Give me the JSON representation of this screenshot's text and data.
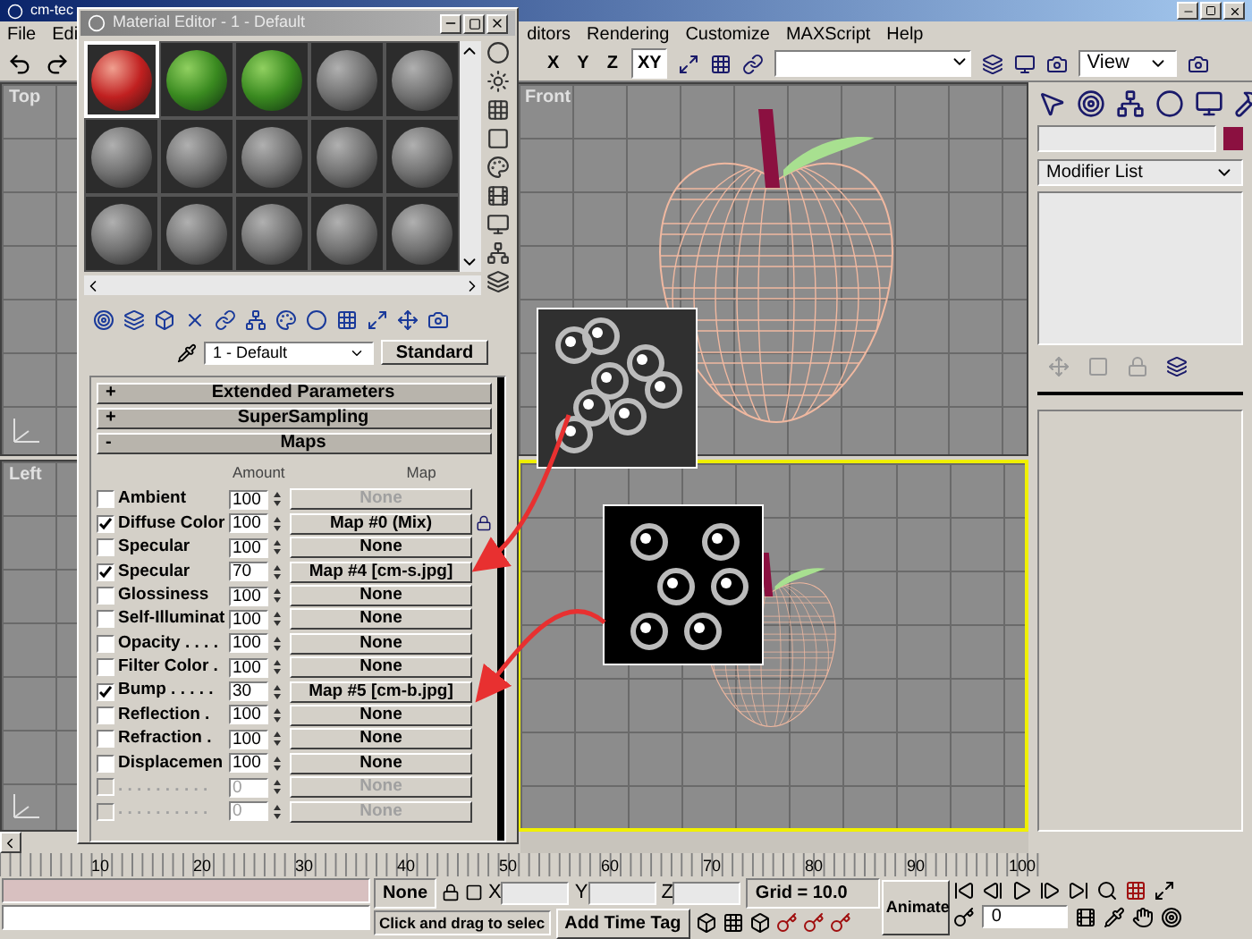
{
  "main_window": {
    "title": "cm-tec"
  },
  "menu": [
    "File",
    "Edi",
    "ditors",
    "Rendering",
    "Customize",
    "MAXScript",
    "Help"
  ],
  "toolbar": {
    "axes": [
      {
        "label": "X",
        "selected": false
      },
      {
        "label": "Y",
        "selected": false
      },
      {
        "label": "Z",
        "selected": false
      },
      {
        "label": "XY",
        "selected": true
      }
    ],
    "view_dropdown": "View"
  },
  "viewports": [
    {
      "label": "Top",
      "active": false
    },
    {
      "label": "Front",
      "active": false
    },
    {
      "label": "Left",
      "active": false
    },
    {
      "active": true
    }
  ],
  "material_editor": {
    "title": "Material Editor - 1 - Default",
    "slots": [
      {
        "kind": "strawberry",
        "selected": true
      },
      {
        "kind": "green",
        "selected": false
      },
      {
        "kind": "green",
        "selected": false
      },
      {
        "kind": "gray",
        "selected": false
      },
      {
        "kind": "gray",
        "selected": false
      },
      {
        "kind": "gray",
        "selected": false
      },
      {
        "kind": "gray",
        "selected": false
      },
      {
        "kind": "gray",
        "selected": false
      },
      {
        "kind": "gray",
        "selected": false
      },
      {
        "kind": "gray",
        "selected": false
      },
      {
        "kind": "gray",
        "selected": false
      },
      {
        "kind": "gray",
        "selected": false
      },
      {
        "kind": "gray",
        "selected": false
      },
      {
        "kind": "gray",
        "selected": false
      },
      {
        "kind": "gray",
        "selected": false
      }
    ],
    "material_name": "1 - Default",
    "material_type": "Standard",
    "rollouts": [
      {
        "sign": "+",
        "label": "Extended Parameters"
      },
      {
        "sign": "+",
        "label": "SuperSampling"
      },
      {
        "sign": "-",
        "label": "Maps"
      }
    ],
    "maps_header": {
      "amount": "Amount",
      "map": "Map"
    },
    "maps": [
      {
        "name": "Ambient",
        "checked": false,
        "amount": "100",
        "map": "None",
        "disabled": false,
        "map_disabled": true
      },
      {
        "name": "Diffuse Color",
        "checked": true,
        "amount": "100",
        "map": "Map #0  (Mix)",
        "disabled": false,
        "map_disabled": false
      },
      {
        "name": "Specular",
        "checked": false,
        "amount": "100",
        "map": "None",
        "disabled": false,
        "map_disabled": false
      },
      {
        "name": "Specular",
        "checked": true,
        "amount": "70",
        "map": "Map #4 [cm-s.jpg]",
        "disabled": false,
        "map_disabled": false
      },
      {
        "name": "Glossiness",
        "checked": false,
        "amount": "100",
        "map": "None",
        "disabled": false,
        "map_disabled": false
      },
      {
        "name": "Self-Illuminat",
        "checked": false,
        "amount": "100",
        "map": "None",
        "disabled": false,
        "map_disabled": false
      },
      {
        "name": "Opacity . . . .",
        "checked": false,
        "amount": "100",
        "map": "None",
        "disabled": false,
        "map_disabled": false
      },
      {
        "name": "Filter Color .",
        "checked": false,
        "amount": "100",
        "map": "None",
        "disabled": false,
        "map_disabled": false
      },
      {
        "name": "Bump . . . . .",
        "checked": true,
        "amount": "30",
        "map": "Map #5 [cm-b.jpg]",
        "disabled": false,
        "map_disabled": false
      },
      {
        "name": "Reflection .",
        "checked": false,
        "amount": "100",
        "map": "None",
        "disabled": false,
        "map_disabled": false
      },
      {
        "name": "Refraction .",
        "checked": false,
        "amount": "100",
        "map": "None",
        "disabled": false,
        "map_disabled": false
      },
      {
        "name": "Displacemen",
        "checked": false,
        "amount": "100",
        "map": "None",
        "disabled": false,
        "map_disabled": false
      },
      {
        "name": ". . . . . . . . . .",
        "checked": false,
        "amount": "0",
        "map": "None",
        "disabled": true,
        "map_disabled": true
      },
      {
        "name": ". . . . . . . . . .",
        "checked": false,
        "amount": "0",
        "map": "None",
        "disabled": true,
        "map_disabled": true
      }
    ]
  },
  "command_panel": {
    "modifier_list": "Modifier List"
  },
  "timeline": {
    "labels": [
      "10",
      "20",
      "30",
      "40",
      "50",
      "60",
      "70",
      "80",
      "90",
      "100"
    ]
  },
  "status_bar": {
    "selection": "None",
    "coords": [
      "X",
      "Y",
      "Z"
    ],
    "grid": "Grid = 10.0",
    "animate": "Animate",
    "frame": "0",
    "prompt": "Click and drag to selec",
    "time_tag": "Add Time Tag"
  }
}
